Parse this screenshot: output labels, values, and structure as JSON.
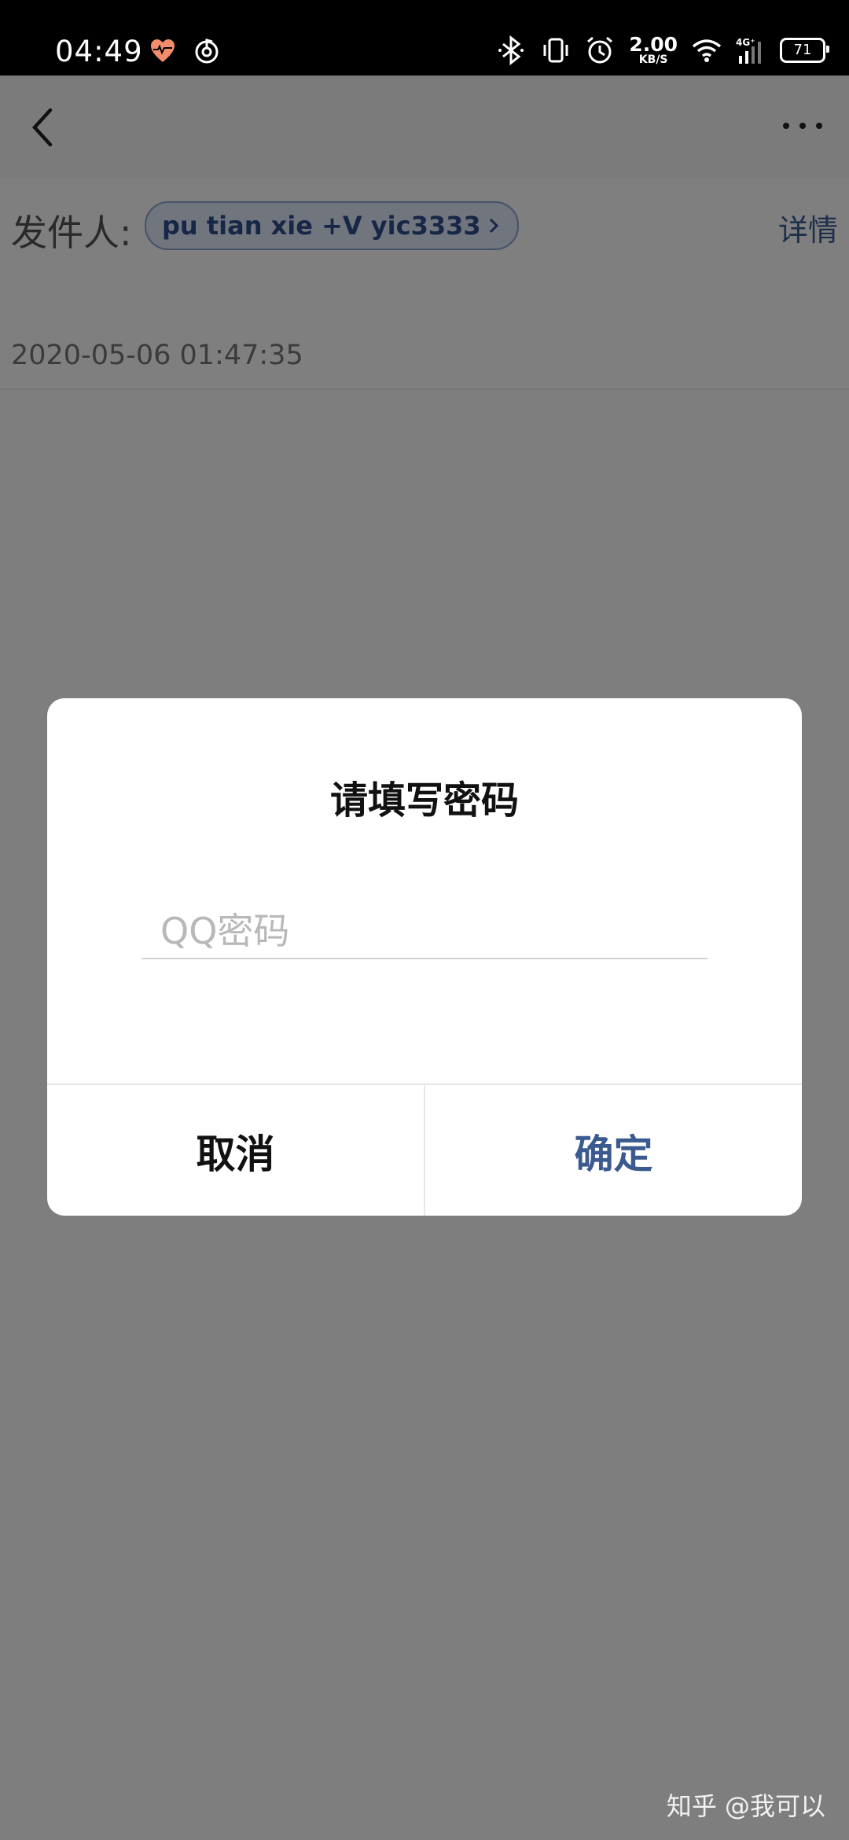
{
  "status_bar": {
    "time": "04:49",
    "net_speed": "2.00",
    "net_unit": "KB/S",
    "battery": "71",
    "icons": [
      "health-icon",
      "music-icon",
      "bluetooth-icon",
      "vibrate-icon",
      "alarm-icon",
      "wifi-icon",
      "signal-4g-icon",
      "battery-icon"
    ]
  },
  "header": {
    "back_icon": "chevron-left-icon",
    "more_icon": "more-dots-icon"
  },
  "mail": {
    "sender_label": "发件人:",
    "sender_name": "pu tian xie +V yic3333",
    "details_label": "详情",
    "date": "2020-05-06 01:47:35"
  },
  "dialog": {
    "title": "请填写密码",
    "password_placeholder": "QQ密码",
    "password_value": "",
    "cancel_label": "取消",
    "confirm_label": "确定"
  },
  "watermark": "知乎 @我可以",
  "colors": {
    "accent": "#3b5a8f",
    "chip_bg": "#e3ebfb",
    "overlay": "rgba(0,0,0,0.5)"
  }
}
